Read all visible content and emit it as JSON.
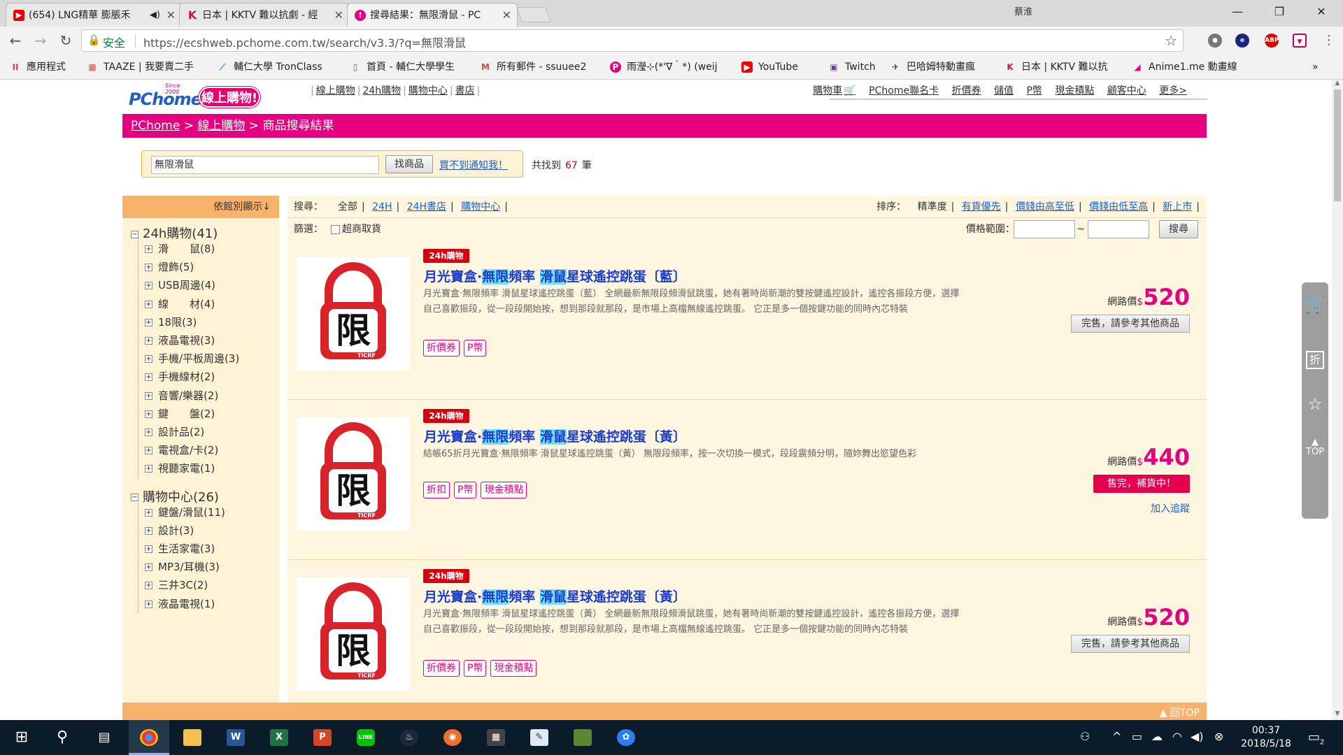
{
  "browser": {
    "tabs": [
      {
        "title": "(654) LNG精華 膨脹禾",
        "icon": "youtube-icon"
      },
      {
        "title": "日本 | KKTV 難以抗劇 - 經",
        "icon": "kktv-icon"
      },
      {
        "title": "搜尋結果：無限滑鼠 - PC",
        "icon": "pchome-icon"
      }
    ],
    "user_label": "蔡淮",
    "security_label": "安全",
    "url": "https://ecshweb.pchome.com.tw/search/v3.3/?q=無限滑鼠",
    "bookmarks": [
      {
        "label": "應用程式",
        "icon": "apps-icon"
      },
      {
        "label": "TAAZE | 我要賣二手",
        "icon": "taaze-icon"
      },
      {
        "label": "輔仁大學 TronClass",
        "icon": "tronclass-icon"
      },
      {
        "label": "首頁 - 輔仁大學學生",
        "icon": "page-icon"
      },
      {
        "label": "所有郵件 - ssuuee2",
        "icon": "gmail-icon"
      },
      {
        "label": "雨瀅⊹(*'∇｀*) (weij",
        "icon": "pixnet-icon"
      },
      {
        "label": "YouTube",
        "icon": "youtube-icon"
      },
      {
        "label": "Twitch",
        "icon": "twitch-icon"
      },
      {
        "label": "巴哈姆特動畫瘋",
        "icon": "bahamut-icon"
      },
      {
        "label": "日本 | KKTV 難以抗",
        "icon": "kktv-icon"
      },
      {
        "label": "Anime1.me 動畫線",
        "icon": "anime1-icon"
      }
    ],
    "more_bookmarks": "»"
  },
  "site": {
    "logo_text": "PChome",
    "logo_since": "Since 2000",
    "logo_slogan": "線上購物!",
    "top_nav": [
      "線上購物",
      "24h購物",
      "購物中心",
      "書店"
    ],
    "top_links": [
      "購物車",
      "PChome聯名卡",
      "折價券",
      "儲值",
      "P幣",
      "現金積點",
      "顧客中心",
      "更多>"
    ],
    "crumbs": {
      "home": "PChome",
      "sep": ">",
      "section": "線上購物",
      "current": "商品搜尋結果"
    }
  },
  "search": {
    "query": "無限滑鼠",
    "button": "找商品",
    "notify": "買不到通知我！",
    "total_prefix": "共找到",
    "total_count": "67",
    "total_suffix": "筆"
  },
  "sidebar": {
    "header": "依館別顯示↓",
    "groups": [
      {
        "label": "24h購物(41)",
        "items": [
          "滑　　鼠(8)",
          "燈飾(5)",
          "USB周邊(4)",
          "線　　材(4)",
          "18限(3)",
          "液晶電視(3)",
          "手機/平板周邊(3)",
          "手機線材(2)",
          "音響/樂器(2)",
          "鍵　　盤(2)",
          "設計品(2)",
          "電視盒/卡(2)",
          "視聽家電(1)"
        ]
      },
      {
        "label": "購物中心(26)",
        "items": [
          "鍵盤/滑鼠(11)",
          "設計(3)",
          "生活家電(3)",
          "MP3/耳機(3)",
          "三井3C(2)",
          "液晶電視(1)"
        ]
      }
    ]
  },
  "filters": {
    "search_label": "搜尋：",
    "sources": [
      "全部",
      "24H",
      "24H書店",
      "購物中心"
    ],
    "sort_label": "排序：",
    "sorts": [
      "精準度",
      "有貨優先",
      "價錢由高至低",
      "價錢由低至高",
      "新上市"
    ],
    "filter_label": "篩選：",
    "store_pickup": "超商取貨",
    "price_label": "價格範圍：",
    "price_sep": "~",
    "price_button": "搜尋"
  },
  "products": [
    {
      "badge": "24h購物",
      "title_parts": [
        "月光寶盒·",
        "無限",
        "頻率 ",
        "滑鼠",
        "星球遙控跳蛋〔藍〕"
      ],
      "desc": "月光寶盒·無限頻率 滑鼠星球遙控跳蛋（藍） 全網最新無限段頻滑鼠跳蛋，她有著時尚新潮的雙按鍵遙控設計，遙控各振段方便，選擇自己喜歡振段，從一段段開始按，想到那段就那段，是市場上高檔無線遙控跳蛋。 它正是多一個按鍵功能的同時內芯特裝",
      "tags": [
        "折價券",
        "P幣"
      ],
      "price_label": "網路價",
      "currency": "$",
      "price": "520",
      "status": "完售，請參考其他商品",
      "status_type": "soldout",
      "follow": ""
    },
    {
      "badge": "24h購物",
      "title_parts": [
        "月光寶盒·",
        "無限",
        "頻率 ",
        "滑鼠",
        "星球遙控跳蛋〔黃〕"
      ],
      "desc": "結帳65折月光寶盒·無限頻率 滑鼠星球遙控跳蛋（黃） 無限段頻率，按一次切換一模式，段段震頻分明，隨妳舞出慾望色彩",
      "tags": [
        "折扣",
        "P幣",
        "現金積點"
      ],
      "price_label": "網路價",
      "currency": "$",
      "price": "440",
      "status": "售完，補貨中！",
      "status_type": "restock",
      "follow": "加入追蹤"
    },
    {
      "badge": "24h購物",
      "title_parts": [
        "月光寶盒·",
        "無限",
        "頻率 ",
        "滑鼠",
        "星球遙控跳蛋〔黃〕"
      ],
      "desc": "月光寶盒·無限頻率 滑鼠星球遙控跳蛋（黃） 全網最新無限段頻滑鼠跳蛋，她有著時尚新潮的雙按鍵遙控設計，遙控各振段方便，選擇自己喜歡振段，從一段段開始按，想到那段就那段，是市場上高檔無線遙控跳蛋。 它正是多一個按鍵功能的同時內芯特裝",
      "tags": [
        "折價券",
        "P幣",
        "現金積點"
      ],
      "price_label": "網路價",
      "currency": "$",
      "price": "520",
      "status": "完售，請參考其他商品",
      "status_type": "soldout",
      "follow": ""
    }
  ],
  "product_image_text": "限",
  "product_image_brand": "TICRF",
  "footer": {
    "top_label": "▲ 回TOP"
  },
  "side_widget": {
    "top_label": "TOP",
    "discount_label": "折"
  },
  "taskbar": {
    "time": "00:37",
    "date": "2018/5/18",
    "notifications": "2"
  },
  "colors": {
    "brand": "#e4007f",
    "logo_blue": "#1f5fbf",
    "panel": "#fff6e0",
    "sidebar_header": "#f9b26b",
    "highlight": "#6fe0ff"
  }
}
